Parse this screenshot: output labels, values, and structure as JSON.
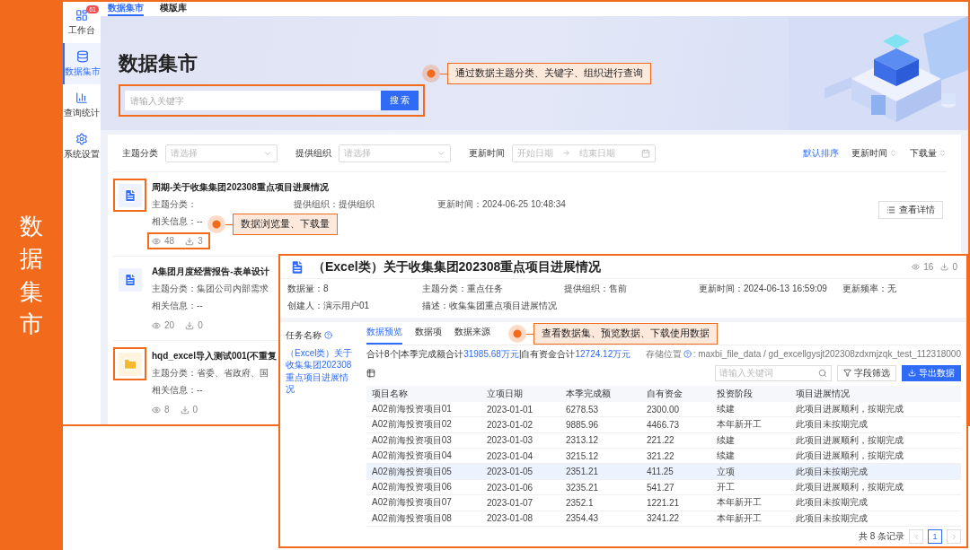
{
  "slide_label": "数据集市",
  "sidebar": {
    "items": [
      {
        "label": "工作台",
        "badge": "61",
        "selected": false
      },
      {
        "label": "数据集市",
        "selected": true
      },
      {
        "label": "查询统计",
        "selected": false
      },
      {
        "label": "系统设置",
        "selected": false
      }
    ]
  },
  "tabs": [
    {
      "label": "数据集市",
      "selected": true
    },
    {
      "label": "模版库",
      "selected": false
    }
  ],
  "banner": {
    "title": "数据集市",
    "search": {
      "placeholder": "请输入关键字",
      "button": "搜 索",
      "highlighted": true
    }
  },
  "filters": [
    {
      "kind": "select",
      "label": "主题分类",
      "placeholder": "请选择"
    },
    {
      "kind": "select",
      "label": "提供组织",
      "placeholder": "请选择"
    },
    {
      "kind": "daterange",
      "label": "更新时间",
      "start_placeholder": "开始日期",
      "end_placeholder": "结束日期"
    }
  ],
  "sorts": [
    {
      "label": "默认排序",
      "selected": true,
      "sortable": false
    },
    {
      "label": "更新时间",
      "selected": false,
      "sortable": true
    },
    {
      "label": "下载量",
      "selected": false,
      "sortable": true
    }
  ],
  "datasets": [
    {
      "kind": "document",
      "icon_highlighted": true,
      "title": "周期-关于收集集团202308重点项目进展情况",
      "meta": [
        {
          "label": "主题分类："
        },
        {
          "label": "提供组织：",
          "value": "提供组织"
        },
        {
          "label": "更新时间：",
          "value": "2024-06-25 10:48:34"
        }
      ],
      "related": {
        "label": "相关信息：",
        "value": "--"
      },
      "views": "48",
      "downloads": "3",
      "stats_highlighted": true,
      "action": "查看详情"
    },
    {
      "kind": "document",
      "icon_highlighted": false,
      "title": "A集团月度经营报告-表单设计",
      "meta": [
        {
          "label": "主题分类：",
          "value": "集团公司内部需求"
        }
      ],
      "related": {
        "label": "相关信息：",
        "value": "--"
      },
      "views": "20",
      "downloads": "0",
      "stats_highlighted": false
    },
    {
      "kind": "folder",
      "icon_highlighted": true,
      "title": "hqd_excel导入测试001(不重复",
      "meta": [
        {
          "label": "主题分类：",
          "value": "省委、省政府、国"
        }
      ],
      "related": {
        "label": "相关信息：",
        "value": "--"
      },
      "views": "8",
      "downloads": "0",
      "stats_highlighted": false
    }
  ],
  "detail": {
    "title": "（Excel类）关于收集集团202308重点项目进展情况",
    "views": "16",
    "downloads": "0",
    "meta": [
      {
        "label": "数据量：",
        "value": "8"
      },
      {
        "label": "主题分类：",
        "value": "重点任务"
      },
      {
        "label": "提供组织：",
        "value": "售前"
      },
      {
        "label": "更新时间：",
        "value": "2024-06-13 16:59:09"
      },
      {
        "label": "更新频率：",
        "value": "无"
      },
      {
        "label": "创建人：",
        "value": "演示用户01"
      },
      {
        "label": "描述：",
        "value": "收集集团重点项目进展情况"
      }
    ],
    "task_label": "任务名称",
    "task_link": "（Excel类）关于收集集团202308重点项目进展情况",
    "tabs": [
      {
        "label": "数据预览",
        "selected": true
      },
      {
        "label": "数据项",
        "selected": false
      },
      {
        "label": "数据来源",
        "selected": false
      }
    ],
    "summary": [
      {
        "text": "合计8个|本季完成额合计",
        "accent": false
      },
      {
        "text": "31985.68万元",
        "accent": true
      },
      {
        "text": "|自有资金合计",
        "accent": false
      },
      {
        "text": "12724.12万元",
        "accent": true
      }
    ],
    "storage_label": "存储位置",
    "storage_value": ": maxbi_file_data / gd_excellgysjt202308zdxmjzqk_test_112318000",
    "search_placeholder": "请输入关键词",
    "filter_button": "字段筛选",
    "export_button": "导出数据",
    "table": {
      "columns": [
        "项目名称",
        "立项日期",
        "本季完成额",
        "自有资金",
        "投资阶段",
        "项目进展情况"
      ],
      "rows": [
        {
          "cells": [
            "A02前海投资项目01",
            "2023-01-01",
            "6278.53",
            "2300.00",
            "续建",
            "此项目进展顺利，按期完成"
          ],
          "selected": false
        },
        {
          "cells": [
            "A02前海投资项目02",
            "2023-01-02",
            "9885.96",
            "4466.73",
            "本年新开工",
            "此项目未按期完成"
          ],
          "selected": false
        },
        {
          "cells": [
            "A02前海投资项目03",
            "2023-01-03",
            "2313.12",
            "221.22",
            "续建",
            "此项目进展顺利，按期完成"
          ],
          "selected": false
        },
        {
          "cells": [
            "A02前海投资项目04",
            "2023-01-04",
            "3215.12",
            "321.22",
            "续建",
            "此项目进展顺利，按期完成"
          ],
          "selected": false
        },
        {
          "cells": [
            "A02前海投资项目05",
            "2023-01-05",
            "2351.21",
            "411.25",
            "立项",
            "此项目未按期完成"
          ],
          "selected": true
        },
        {
          "cells": [
            "A02前海投资项目06",
            "2023-01-06",
            "3235.21",
            "541.27",
            "开工",
            "此项目进展顺利，按期完成"
          ],
          "selected": false
        },
        {
          "cells": [
            "A02前海投资项目07",
            "2023-01-07",
            "2352.1",
            "1221.21",
            "本年新开工",
            "此项目未按期完成"
          ],
          "selected": false
        },
        {
          "cells": [
            "A02前海投资项目08",
            "2023-01-08",
            "2354.43",
            "3241.22",
            "本年新开工",
            "此项目未按期完成"
          ],
          "selected": false
        }
      ]
    },
    "total": "共 8 条记录",
    "page": "1"
  },
  "callouts": [
    {
      "text": "通过数据主题分类、关键字、组织进行查询"
    },
    {
      "text": "数据浏览量、下载量"
    },
    {
      "text": "查看数据集、预览数据、下载使用数据"
    }
  ]
}
